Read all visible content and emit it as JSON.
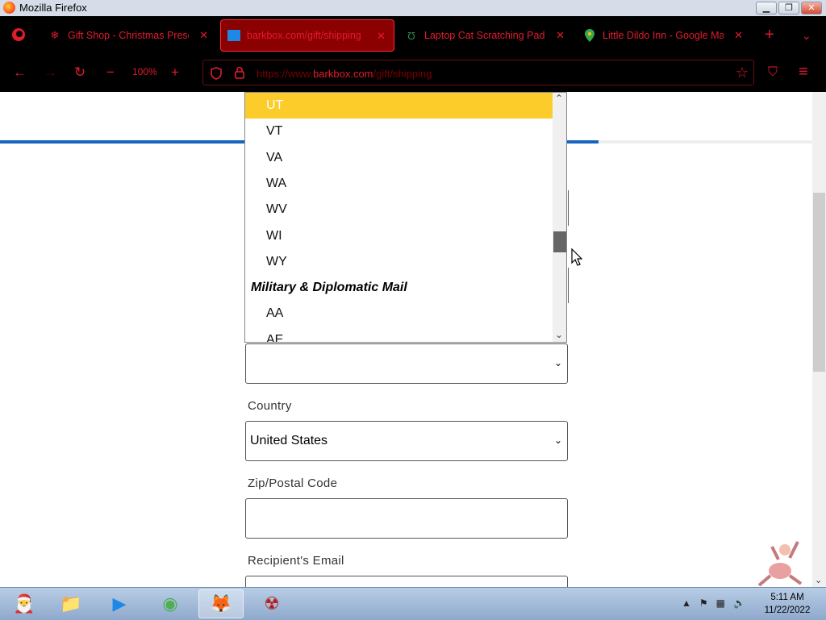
{
  "window": {
    "title": "Mozilla Firefox",
    "btn_minimize": "▁",
    "btn_restore": "❐",
    "btn_close": "✕"
  },
  "tabs": [
    {
      "label": "Gift Shop - Christmas Present",
      "icon": "snowflake-icon",
      "glyph": "❄"
    },
    {
      "label": "barkbox.com/gift/shipping",
      "icon": "barkbox-favicon",
      "glyph": "▮"
    },
    {
      "label": "Laptop Cat Scratching Pad | Ca",
      "icon": "uncommon-goods-favicon",
      "glyph": "Ʊ"
    },
    {
      "label": "Little Dildo Inn - Google Maps",
      "icon": "google-maps-pin-icon",
      "glyph": "⬤"
    }
  ],
  "tab_close": "✕",
  "toolbar": {
    "new_tab": "+",
    "tab_list": "⌄",
    "back": "←",
    "forward": "→",
    "reload": "↻",
    "zoom_out": "−",
    "zoom_level": "100%",
    "zoom_in": "+",
    "url_prefix": "https://www.",
    "url_domain": "barkbox.com",
    "url_path": "/gift/shipping",
    "bookmark": "☆",
    "pocket": "⛉",
    "menu": "≡"
  },
  "form": {
    "progress_fraction": 0.737,
    "state_value": "",
    "country_label": "Country",
    "country_value": "United States",
    "zip_label": "Zip/Postal Code",
    "zip_value": "",
    "email_label": "Recipient's Email",
    "chevron": "⌄"
  },
  "dropdown": {
    "options": [
      "UT",
      "VT",
      "VA",
      "WA",
      "WV",
      "WI",
      "WY"
    ],
    "selected": "UT",
    "group_label": "Military & Diplomatic Mail",
    "group_options": [
      "AA",
      "AE"
    ],
    "scroll_up": "⌃",
    "scroll_down": "⌄",
    "scroll_fraction": 0.62
  },
  "page_scroll_fraction": 0.31,
  "taskbar": {
    "apps": [
      {
        "name": "santa-start-button",
        "glyph": "🎅"
      },
      {
        "name": "file-explorer-icon",
        "glyph": "📁"
      },
      {
        "name": "media-player-icon",
        "glyph": "▶"
      },
      {
        "name": "chrome-icon",
        "glyph": "◉"
      },
      {
        "name": "firefox-icon",
        "glyph": "🦊"
      },
      {
        "name": "radiation-app-icon",
        "glyph": "☢"
      }
    ],
    "tray_up": "▲",
    "time": "5:11 AM",
    "date": "11/22/2022"
  },
  "colors": {
    "accent": "#e21b2d",
    "highlight": "#fccd2a",
    "progress": "#1565c0"
  }
}
